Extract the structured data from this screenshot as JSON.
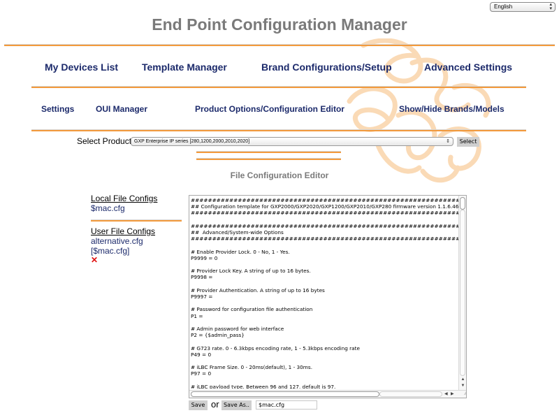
{
  "language_select": {
    "value": "English"
  },
  "app_title": "End Point Configuration Manager",
  "primary_nav": [
    {
      "label": "My Devices List"
    },
    {
      "label": "Template Manager"
    },
    {
      "label": "Brand Configurations/Setup"
    },
    {
      "label": "Advanced Settings"
    }
  ],
  "secondary_nav": [
    {
      "label": "Settings"
    },
    {
      "label": "OUI Manager"
    },
    {
      "label": "Product Options/Configuration Editor"
    },
    {
      "label": "Show/Hide Brands/Models"
    }
  ],
  "product_selector": {
    "label": "Select Product",
    "value": "GXP Enterprise IP series [280,1200,2000,2010,2020]",
    "button_label": "Select"
  },
  "section_title": "File Configuration Editor",
  "sidebar": {
    "local_heading": "Local File Configs",
    "local_files": [
      "$mac.cfg"
    ],
    "user_heading": "User File Configs",
    "user_files": [
      "alternative.cfg [$mac.cfg]"
    ],
    "delete_glyph": "✕"
  },
  "editor": {
    "content": "##############################################################################\n## Configuration template for GXP2000/GXP2020/GXP1200/GXP2010/GXP280 firmware version 1.1.6.46\n##############################################################################\n\n##############################################################################\n##  Advanced/System-wide Options\n##############################################################################\n\n# Enable Provider Lock. 0 - No, 1 - Yes.\nP9999 = 0\n\n# Provider Lock Key. A string of up to 16 bytes.\nP9998 =\n\n# Provider Authentication. A string of up to 16 bytes\nP9997 =\n\n# Password for configuration file authentication\nP1 =\n\n# Admin password for web interface\nP2 = {$admin_pass}\n\n# G723 rate. 0 - 6.3kbps encoding rate, 1 - 5.3kbps encoding rate\nP49 = 0\n\n# iLBC Frame Size. 0 - 20ms(default), 1 - 30ms.\nP97 = 0\n\n# iLBC payload type. Between 96 and 127, default is 97."
  },
  "save_row": {
    "save_label": "Save",
    "or_label": "or",
    "save_as_label": "Save As..",
    "save_as_value": "$mac.cfg"
  },
  "colors": {
    "accent_orange": "#f39a3c",
    "nav_link": "#1c2a6b",
    "title_gray": "#7a7a7a",
    "delete_red": "#e01010"
  }
}
